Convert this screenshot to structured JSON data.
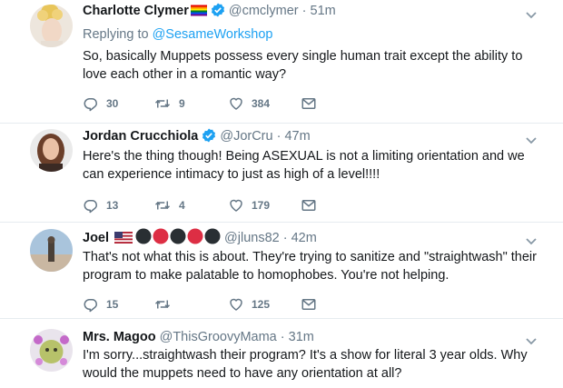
{
  "tweets": [
    {
      "name": "Charlotte Clymer",
      "handle": "@cmclymer",
      "sep": " · ",
      "time": "51m",
      "reply_prefix": "Replying to ",
      "reply_to": "@SesameWorkshop",
      "text": "So, basically Muppets possess every single human trait except the ability to love each other in a romantic way?",
      "replies": "30",
      "retweets": "9",
      "likes": "384"
    },
    {
      "name": "Jordan Crucchiola",
      "handle": "@JorCru",
      "sep": " · ",
      "time": "47m",
      "text": "Here's the thing though! Being ASEXUAL is not a limiting orientation and we can experience intimacy to just as high of a level!!!!",
      "replies": "13",
      "retweets": "4",
      "likes": "179"
    },
    {
      "name": "Joel",
      "handle": "@jluns82",
      "sep": " · ",
      "time": "42m",
      "text": "That's not what this is about. They're trying to sanitize and \"straightwash\" their program to make palatable to homophobes. You're not helping.",
      "replies": "15",
      "retweets": "",
      "likes": "125"
    },
    {
      "name": "Mrs. Magoo",
      "handle": "@ThisGroovyMama",
      "sep": " · ",
      "time": "31m",
      "text": "I'm sorry...straightwash their program? It's a show for literal 3 year olds. Why would the muppets need to have any orientation at all?"
    }
  ],
  "icons": {
    "reply": "reply-icon",
    "retweet": "retweet-icon",
    "like": "heart-icon",
    "dm": "envelope-icon",
    "caret": "chevron-down-icon",
    "verified": "verified-badge-icon"
  },
  "colors": {
    "text": "#14171a",
    "muted": "#657786",
    "link": "#1da1f2",
    "divider": "#e6ecf0"
  }
}
